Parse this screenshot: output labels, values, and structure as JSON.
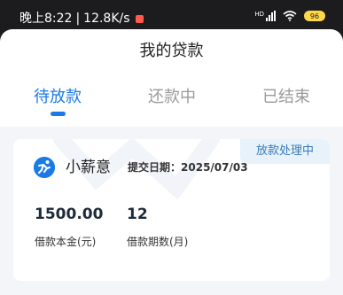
{
  "status_bar": {
    "time": "晚上8:22",
    "separator": "|",
    "speed": "12.8K/s",
    "signal_label": "HD",
    "battery_level": "96"
  },
  "header": {
    "title": "我的贷款"
  },
  "tabs": [
    {
      "label": "待放款",
      "active": true
    },
    {
      "label": "还款中",
      "active": false
    },
    {
      "label": "已结束",
      "active": false
    }
  ],
  "loan_card": {
    "status": "放款处理中",
    "brand_name": "小薪意",
    "brand_icon": "runner-logo-icon",
    "submit_date_label": "提交日期：",
    "submit_date": "2025/07/03",
    "principal_value": "1500.00",
    "principal_label": "借款本金(元)",
    "term_value": "12",
    "term_label": "借款期数(月)"
  },
  "colors": {
    "accent": "#1a7ae8",
    "background": "#f3f5f8",
    "badge_bg": "#e7f2fb",
    "badge_text": "#3a7bb8"
  }
}
